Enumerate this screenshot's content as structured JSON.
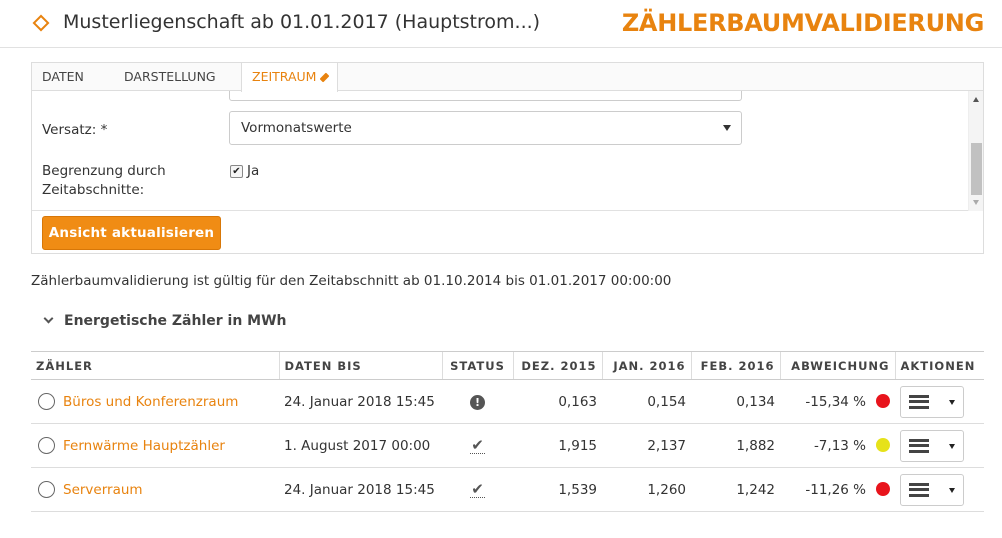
{
  "header": {
    "title": "Musterliegenschaft ab 01.01.2017 (Hauptstrom...)",
    "app_title": "ZÄHLERBAUMVALIDIERUNG"
  },
  "tabs": [
    {
      "label": "DATEN"
    },
    {
      "label": "DARSTELLUNG"
    },
    {
      "label": "ZEITRAUM"
    }
  ],
  "form": {
    "versatz_label": "Versatz: *",
    "versatz_value": "Vormonatswerte",
    "begrenzung_label_1": "Begrenzung durch",
    "begrenzung_label_2": "Zeitabschnitte:",
    "begrenzung_checked": true,
    "begrenzung_option": "Ja",
    "update_button": "Ansicht aktualisieren"
  },
  "validity_text": "Zählerbaumvalidierung ist gültig für den Zeitabschnitt ab 01.10.2014 bis 01.01.2017 00:00:00",
  "section_title": "Energetische Zähler in MWh",
  "table": {
    "columns": [
      "ZÄHLER",
      "DATEN BIS",
      "STATUS",
      "DEZ. 2015",
      "JAN. 2016",
      "FEB. 2016",
      "ABWEICHUNG",
      "AKTIONEN"
    ],
    "rows": [
      {
        "name": "Büros und Konferenzraum",
        "daten_bis": "24. Januar 2018 15:45",
        "status": "warning",
        "dez": "0,163",
        "jan": "0,154",
        "feb": "0,134",
        "abweichung": "-15,34 %",
        "dot_color": "#e8141c"
      },
      {
        "name": "Fernwärme Hauptzähler",
        "daten_bis": "1. August 2017 00:00",
        "status": "ok",
        "dez": "1,915",
        "jan": "2,137",
        "feb": "1,882",
        "abweichung": "-7,13 %",
        "dot_color": "#e6e21a"
      },
      {
        "name": "Serverraum",
        "daten_bis": "24. Januar 2018 15:45",
        "status": "ok",
        "dez": "1,539",
        "jan": "1,260",
        "feb": "1,242",
        "abweichung": "-11,26 %",
        "dot_color": "#e8141c"
      }
    ]
  },
  "colors": {
    "accent": "#e8830f",
    "button": "#f08c14",
    "status_red": "#e8141c",
    "status_yellow": "#e6e21a"
  },
  "icons": {
    "status_warning": "exclamation-circle-icon",
    "status_ok": "checkmark-icon",
    "actions": "hamburger-menu-icon"
  }
}
